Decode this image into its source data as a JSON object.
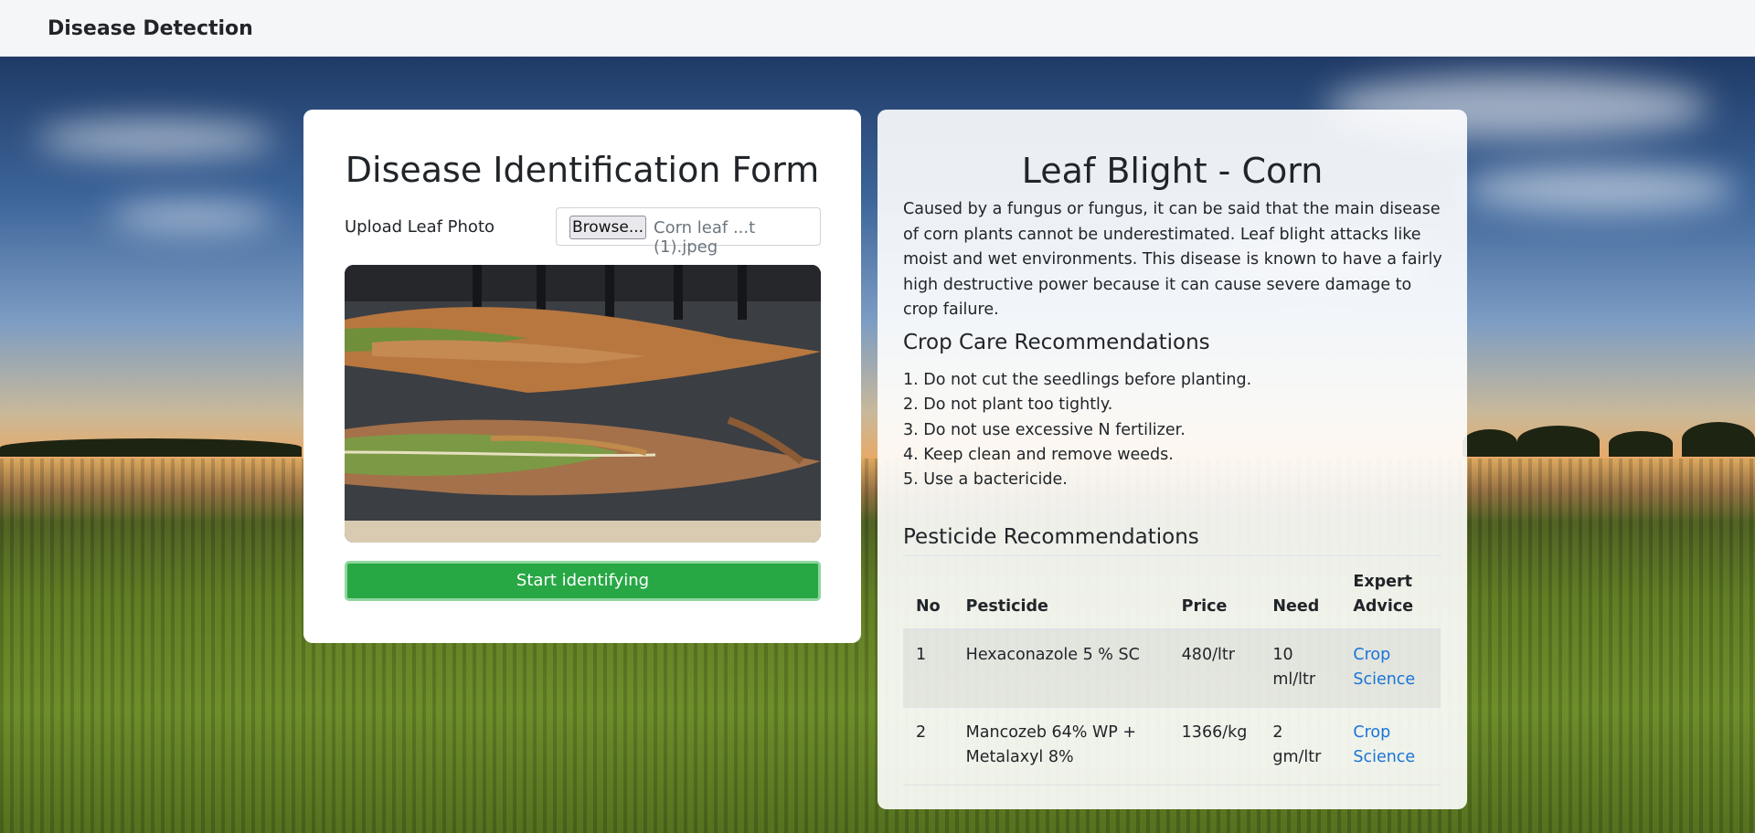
{
  "navbar": {
    "brand": "Disease Detection"
  },
  "form": {
    "title": "Disease Identification Form",
    "upload_label": "Upload Leaf Photo",
    "browse_label": "Browse...",
    "file_name": "Corn leaf ...t (1).jpeg",
    "submit_label": "Start identifying"
  },
  "result": {
    "title": "Leaf Blight - Corn",
    "description": "Caused by a fungus or fungus, it can be said that the main disease of corn plants cannot be underestimated. Leaf blight attacks like moist and wet environments. This disease is known to have a fairly high destructive power because it can cause severe damage to crop failure.",
    "care_title": "Crop Care Recommendations",
    "care_items": [
      "1. Do not cut the seedlings before planting.",
      "2. Do not plant too tightly.",
      "3. Do not use excessive N fertilizer.",
      "4. Keep clean and remove weeds.",
      "5. Use a bactericide."
    ],
    "pesticide_title": "Pesticide Recommendations",
    "table": {
      "headers": [
        "No",
        "Pesticide",
        "Price",
        "Need",
        "Expert Advice"
      ],
      "rows": [
        {
          "no": "1",
          "pesticide": "Hexaconazole 5 % SC",
          "price": "480/ltr",
          "need": "10 ml/ltr",
          "advice": "Crop Science"
        },
        {
          "no": "2",
          "pesticide": "Mancozeb 64% WP + Metalaxyl 8%",
          "price": "1366/kg",
          "need": "2 gm/ltr",
          "advice": "Crop Science"
        }
      ]
    }
  }
}
